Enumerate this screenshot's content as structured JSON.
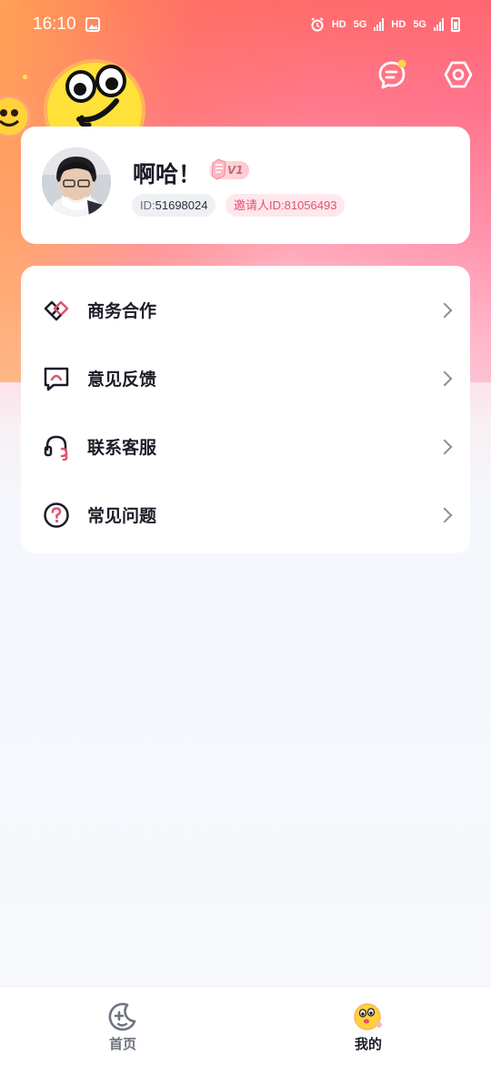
{
  "status_bar": {
    "time": "16:10",
    "hd1": "HD",
    "net1": "5G",
    "hd2": "HD",
    "net2": "5G"
  },
  "header": {
    "message_icon": "message-icon",
    "settings_icon": "hexagon-settings-icon"
  },
  "profile": {
    "name": "啊哈！",
    "level_badge": "V1",
    "id_label": "ID:",
    "id_value": "51698024",
    "inviter": "邀请人ID:81056493"
  },
  "menu": {
    "items": [
      {
        "label": "商务合作",
        "icon": "handshake-icon"
      },
      {
        "label": "意见反馈",
        "icon": "feedback-icon"
      },
      {
        "label": "联系客服",
        "icon": "headset-icon"
      },
      {
        "label": "常见问题",
        "icon": "question-icon"
      }
    ]
  },
  "tabbar": {
    "home_label": "首页",
    "mine_label": "我的"
  },
  "colors": {
    "accent": "#e05270",
    "text_primary": "#1c1c28",
    "card_bg": "#ffffff"
  }
}
